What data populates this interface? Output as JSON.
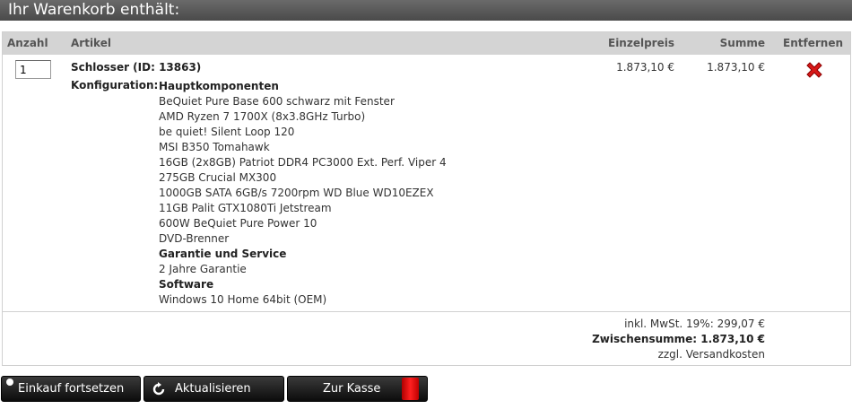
{
  "header": {
    "title": "Ihr Warenkorb enthält:"
  },
  "table": {
    "columns": {
      "qty": "Anzahl",
      "article": "Artikel",
      "unit_price": "Einzelpreis",
      "sum": "Summe",
      "remove": "Entfernen"
    }
  },
  "item": {
    "quantity": "1",
    "name": "Schlosser (ID: 13863)",
    "config_label": "Konfiguration:",
    "config_lines": [
      {
        "text": "Hauptkomponenten",
        "bold": true
      },
      {
        "text": "BeQuiet Pure Base 600 schwarz mit Fenster",
        "bold": false
      },
      {
        "text": "AMD Ryzen 7 1700X (8x3.8GHz Turbo)",
        "bold": false
      },
      {
        "text": "be quiet! Silent Loop 120",
        "bold": false
      },
      {
        "text": "MSI B350 Tomahawk",
        "bold": false
      },
      {
        "text": "16GB (2x8GB) Patriot DDR4 PC3000 Ext. Perf. Viper 4",
        "bold": false
      },
      {
        "text": "275GB Crucial MX300",
        "bold": false
      },
      {
        "text": "1000GB SATA 6GB/s 7200rpm WD Blue WD10EZEX",
        "bold": false
      },
      {
        "text": "11GB Palit GTX1080Ti Jetstream",
        "bold": false
      },
      {
        "text": "600W BeQuiet Pure Power 10",
        "bold": false
      },
      {
        "text": "DVD-Brenner",
        "bold": false
      },
      {
        "text": "Garantie und Service",
        "bold": true
      },
      {
        "text": "2 Jahre Garantie",
        "bold": false
      },
      {
        "text": "Software",
        "bold": true
      },
      {
        "text": "Windows 10 Home 64bit (OEM)",
        "bold": false
      }
    ],
    "unit_price": "1.873,10 €",
    "sum": "1.873,10 €",
    "remove_icon": "remove-x-icon",
    "remove_color": "#d81818"
  },
  "totals": {
    "vat": "inkl. MwSt. 19%: 299,07 €",
    "subtotal": "Zwischensumme: 1.873,10 €",
    "shipping": "zzgl. Versandkosten"
  },
  "buttons": {
    "continue": "Einkauf fortsetzen",
    "update": "Aktualisieren",
    "checkout": "Zur Kasse"
  },
  "colors": {
    "header_bg": "#555555",
    "table_header_bg": "#d4d4d4",
    "button_bg": "#1a1a1a",
    "checkout_accent": "#e01010"
  }
}
